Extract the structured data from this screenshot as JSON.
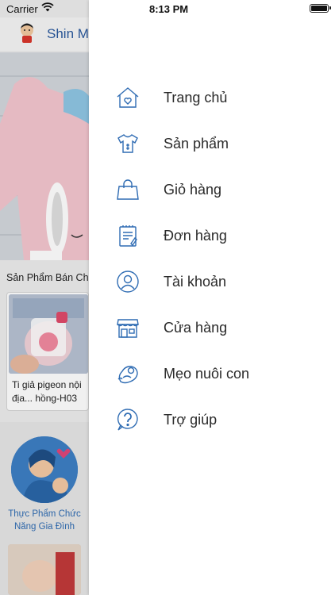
{
  "status_bar": {
    "carrier": "Carrier",
    "time": "8:13 PM"
  },
  "app": {
    "title": "Shin M",
    "section_title": "Sản Phẩm Bán Ch",
    "product": {
      "name_line1": "Ti giả pigeon nội",
      "name_line2": "địa... hồng-H03"
    },
    "category": {
      "label": "Thực Phẩm Chức Năng Gia Đình"
    }
  },
  "menu": {
    "items": [
      {
        "label": "Trang chủ",
        "icon": "home-icon"
      },
      {
        "label": "Sản phẩm",
        "icon": "baby-clothes-icon"
      },
      {
        "label": "Giỏ hàng",
        "icon": "shopping-bag-icon"
      },
      {
        "label": "Đơn hàng",
        "icon": "order-list-icon"
      },
      {
        "label": "Tài khoản",
        "icon": "user-account-icon"
      },
      {
        "label": "Cửa hàng",
        "icon": "store-icon"
      },
      {
        "label": "Mẹo nuôi con",
        "icon": "baby-tips-icon"
      },
      {
        "label": "Trợ giúp",
        "icon": "help-icon"
      }
    ]
  },
  "colors": {
    "icon": "#2f6cb3",
    "text": "#2a2a2a",
    "app_title": "#2b5a9e"
  }
}
